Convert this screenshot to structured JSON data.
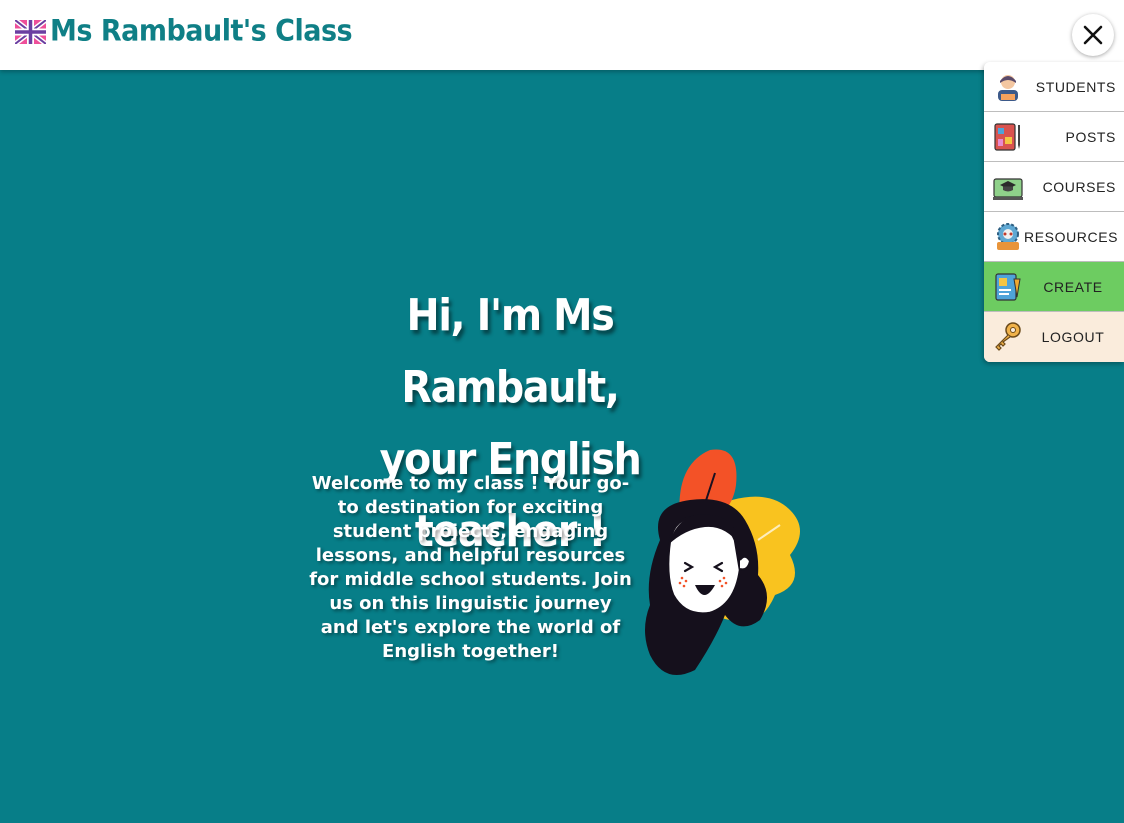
{
  "header": {
    "brand_title": "Ms Rambault's Class",
    "brand_icon": "uk-flag-icon",
    "close_icon": "close-icon"
  },
  "menu": {
    "items": [
      {
        "label": "STUDENTS",
        "icon": "student-icon"
      },
      {
        "label": "POSTS",
        "icon": "posts-icon"
      },
      {
        "label": "COURSES",
        "icon": "courses-icon"
      },
      {
        "label": "RESOURCES",
        "icon": "resources-icon"
      },
      {
        "label": "CREATE",
        "icon": "create-icon"
      },
      {
        "label": "LOGOUT",
        "icon": "key-icon"
      }
    ]
  },
  "hero": {
    "title_line1": "Hi, I'm Ms Rambault,",
    "title_line2": "your English teacher !",
    "intro": "Welcome to my class ! Your go-to destination for exciting student projects, engaging lessons, and helpful resources for middle school students. Join us on this linguistic journey and let's explore the world of English together!"
  },
  "colors": {
    "background": "#077e88",
    "brand": "#0f7f86",
    "create": "#6dcc61",
    "logout": "#faecdc"
  }
}
